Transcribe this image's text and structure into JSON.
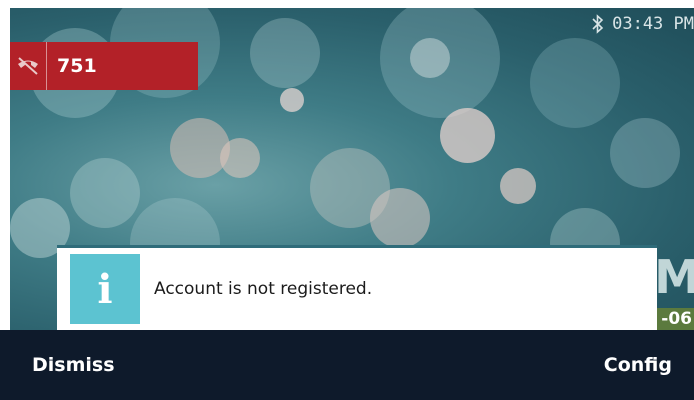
{
  "status_bar": {
    "bluetooth_icon": "bluetooth-icon",
    "time": "03:43 PM"
  },
  "line_key": {
    "icon": "phone-off-icon",
    "label": "751",
    "color": "#b32128"
  },
  "idle_screen": {
    "partial_text": "M",
    "partial_date": "-06"
  },
  "popup": {
    "icon": "info-icon",
    "icon_glyph": "i",
    "message": "Account is not registered."
  },
  "softkeys": {
    "left_label": "Dismiss",
    "right_label": "Config"
  },
  "colors": {
    "softkey_bar": "#0e1a2b",
    "info_accent": "#5cc3d1"
  }
}
